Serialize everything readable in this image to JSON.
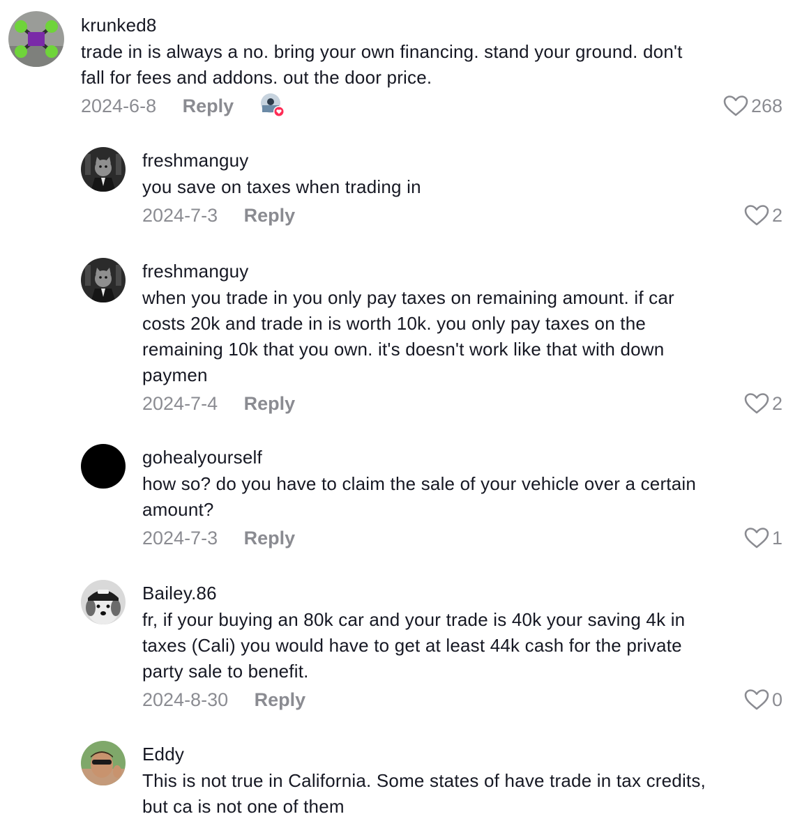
{
  "comments": [
    {
      "username": "krunked8",
      "text": "trade in is always a no. bring your own financing. stand your ground. don't\nfall for fees and addons. out the door price.",
      "date": "2024-6-8",
      "reply_label": "Reply",
      "likes": "268",
      "avatar_icon": "drone-avatar",
      "liked_by_author": true
    },
    {
      "username": "freshmanguy",
      "text": "you save on taxes when trading in",
      "date": "2024-7-3",
      "reply_label": "Reply",
      "likes": "2",
      "avatar_icon": "cat-in-suit-avatar"
    },
    {
      "username": "freshmanguy",
      "text": "when you trade in you only pay taxes on remaining amount. if car\ncosts 20k and trade in is worth 10k. you only pay taxes on the\nremaining 10k that you own. it's doesn't work like that with down\npaymen",
      "date": "2024-7-4",
      "reply_label": "Reply",
      "likes": "2",
      "avatar_icon": "cat-in-suit-avatar"
    },
    {
      "username": "gohealyourself",
      "text": "how so? do you have to claim the sale of your vehicle over a certain\namount?",
      "date": "2024-7-3",
      "reply_label": "Reply",
      "likes": "1",
      "avatar_icon": "black-avatar"
    },
    {
      "username": "Bailey.86",
      "text": "fr, if your buying an 80k car and your trade is 40k your saving 4k in\ntaxes (Cali) you would have to get at least 44k cash for the private\nparty sale to benefit.",
      "date": "2024-8-30",
      "reply_label": "Reply",
      "likes": "0",
      "avatar_icon": "dog-in-cap-avatar"
    },
    {
      "username": "Eddy",
      "text": "This is not true in California. Some states of have trade in tax credits,\nbut ca is not one of them",
      "avatar_icon": "man-sunglasses-avatar"
    }
  ],
  "icons": {
    "like": "heart-outline-icon",
    "liked_by_creator": "creator-liked-badge-icon"
  },
  "colors": {
    "text": "#161823",
    "muted": "rgba(22,24,35,0.5)",
    "heart_badge": "#fe2c55"
  }
}
